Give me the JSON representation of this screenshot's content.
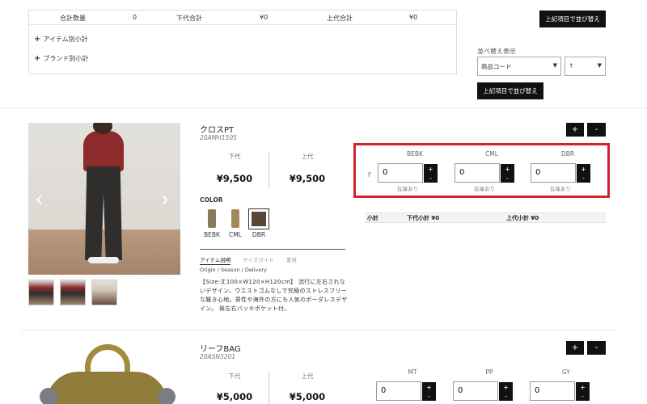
{
  "summary": {
    "total_qty_label": "合計数量",
    "total_qty_value": "0",
    "wholesale_total_label": "下代合計",
    "wholesale_total_value": "¥0",
    "retail_total_label": "上代合計",
    "retail_total_value": "¥0",
    "item_subtotal_label": "アイテム別小計",
    "brand_subtotal_label": "ブランド別小計"
  },
  "sort": {
    "sort_button_label": "上記項目で並び替え",
    "sort_label": "並べ替え表示",
    "sort_field_value": "商品コード",
    "sort_order_value": "↑"
  },
  "products": [
    {
      "name": "クロスPT",
      "code": "20AMH1505",
      "wholesale_label": "下代",
      "wholesale_price": "¥9,500",
      "retail_label": "上代",
      "retail_price": "¥9,500",
      "color_heading": "COLOR",
      "colors": [
        "BEBK",
        "CML",
        "DBR"
      ],
      "selected_color": "DBR",
      "tabs": [
        "アイテム説明",
        "サイズガイド",
        "素材"
      ],
      "active_tab": "アイテム説明",
      "origin_line": "Origin / Season / Delivery",
      "description": "【Size:丈100×W120×H120cm】 流行に左右されないデザイン。ウエストゴムなしで究極のストレスフリーな履き心地。男性や海外の方にも人気のボーダレスデザイン。 後左右バッキポケット付。",
      "size_label": "F",
      "quantities": [
        {
          "color": "BEBK",
          "value": "0",
          "stock": "在庫あり"
        },
        {
          "color": "CML",
          "value": "0",
          "stock": "在庫あり"
        },
        {
          "color": "DBR",
          "value": "0",
          "stock": "在庫あり"
        }
      ],
      "subtotal_label": "小計",
      "wholesale_subtotal": "下代小計 ¥0",
      "retail_subtotal": "上代小計 ¥0"
    },
    {
      "name": "リーフBAG",
      "code": "20ASN3201",
      "wholesale_label": "下代",
      "wholesale_price": "¥5,000",
      "retail_label": "上代",
      "retail_price": "¥5,000",
      "quantities": [
        {
          "color": "MT",
          "value": "0"
        },
        {
          "color": "PP",
          "value": "0"
        },
        {
          "color": "GY",
          "value": "0"
        }
      ]
    }
  ],
  "controls": {
    "expand_all": "+",
    "collapse_all": "-",
    "stepper_plus": "+",
    "stepper_minus": "-",
    "expander_symbol": "+",
    "prev_arrow": "‹",
    "next_arrow": "›"
  },
  "colors": {
    "highlight": "#d0232b",
    "button": "#111111",
    "swatch_bebk": "#8a7a5c",
    "swatch_cml": "#a48a5a",
    "swatch_dbr": "#5b4634"
  }
}
